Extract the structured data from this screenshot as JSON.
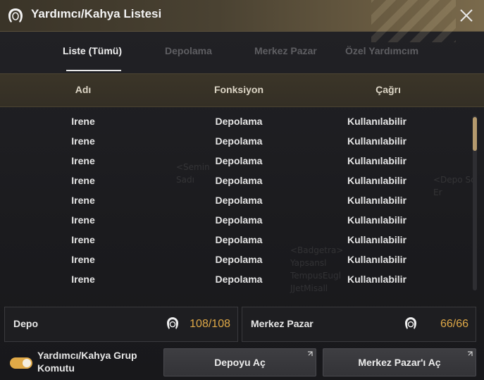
{
  "window": {
    "title": "Yardımcı/Kahya Listesi"
  },
  "tabs": [
    {
      "label": "Liste (Tümü)",
      "active": true
    },
    {
      "label": "Depolama",
      "active": false
    },
    {
      "label": "Merkez Pazar",
      "active": false
    },
    {
      "label": "Özel Yardımcım",
      "active": false
    }
  ],
  "table": {
    "headers": [
      "Adı",
      "Fonksiyon",
      "Çağrı"
    ],
    "rows": [
      [
        "Irene",
        "Depolama",
        "Kullanılabilir"
      ],
      [
        "Irene",
        "Depolama",
        "Kullanılabilir"
      ],
      [
        "Irene",
        "Depolama",
        "Kullanılabilir"
      ],
      [
        "Irene",
        "Depolama",
        "Kullanılabilir"
      ],
      [
        "Irene",
        "Depolama",
        "Kullanılabilir"
      ],
      [
        "Irene",
        "Depolama",
        "Kullanılabilir"
      ],
      [
        "Irene",
        "Depolama",
        "Kullanılabilir"
      ],
      [
        "Irene",
        "Depolama",
        "Kullanılabilir"
      ],
      [
        "Irene",
        "Depolama",
        "Kullanılabilir"
      ]
    ]
  },
  "panels": {
    "depo": {
      "label": "Depo",
      "current": "108",
      "max": "108"
    },
    "pazar": {
      "label": "Merkez Pazar",
      "current": "66",
      "max": "66"
    }
  },
  "footer": {
    "toggle_label": "Yardımcı/Kahya Grup Komutu",
    "toggle_on": true,
    "open_storage_button": "Depoyu Aç",
    "open_market_button": "Merkez Pazar'ı Aç"
  },
  "colors": {
    "accent": "#e0a947",
    "title_bar": "#4a4232",
    "header_row": "#3b3528"
  },
  "icons": {
    "title": "maid-icon",
    "close": "close-icon",
    "capacity": "maid-icon",
    "external": "external-link-icon"
  }
}
